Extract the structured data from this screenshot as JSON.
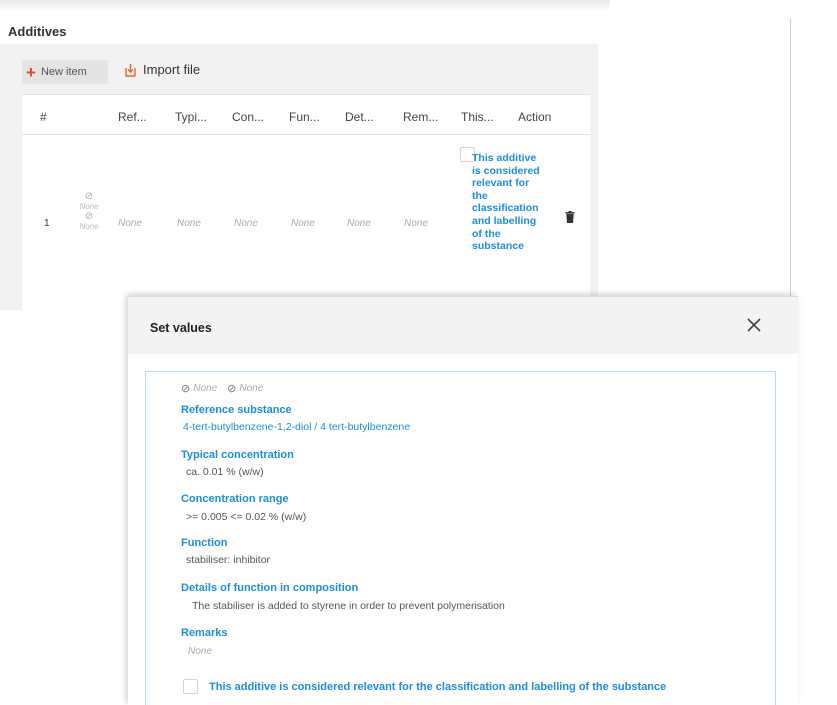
{
  "section": {
    "title": "Additives",
    "toolbar": {
      "new_item_icon": "plus-icon",
      "new_item_label": "New item",
      "import_icon": "import-file-icon",
      "import_label": "Import file"
    },
    "table": {
      "columns": [
        "#",
        "Ref...",
        "Typi...",
        "Con...",
        "Fun...",
        "Det...",
        "Rem...",
        "This...",
        "Action"
      ],
      "rows": [
        {
          "num": "1",
          "icon_top_label": "None",
          "icon_bottom_label": "None",
          "ref": "None",
          "typical": "None",
          "concentration": "None",
          "function": "None",
          "details": "None",
          "remarks": "None",
          "relevance_label": "This additive is considered relevant for the classification and labelling of the substance",
          "relevance_checked": false,
          "action_icon": "trash-icon"
        }
      ]
    }
  },
  "modal": {
    "title": "Set values",
    "close_icon": "close-icon",
    "status_icons": [
      {
        "icon": "blocked-icon",
        "label": "None"
      },
      {
        "icon": "blocked-icon",
        "label": "None"
      }
    ],
    "fields": {
      "reference_substance": {
        "label": "Reference substance",
        "value": "4-tert-butylbenzene-1,2-diol / 4 tert-butylbenzene"
      },
      "typical_concentration": {
        "label": "Typical concentration",
        "value": "ca. 0.01  % (w/w)"
      },
      "concentration_range": {
        "label": "Concentration range",
        "value": ">= 0.005  <= 0.02  % (w/w)"
      },
      "function": {
        "label": "Function",
        "value": "stabiliser: inhibitor"
      },
      "details": {
        "label": "Details of function in composition",
        "value": "The stabiliser is added to styrene in order to prevent polymerisation"
      },
      "remarks": {
        "label": "Remarks",
        "value": "None"
      }
    },
    "relevance_label": "This additive is considered relevant for the classification and labelling of the substance",
    "relevance_checked": false
  },
  "colors": {
    "accent_blue": "#1a8fd8",
    "plus_orange": "#e04a1f",
    "import_icon_orange": "#e8662a"
  }
}
